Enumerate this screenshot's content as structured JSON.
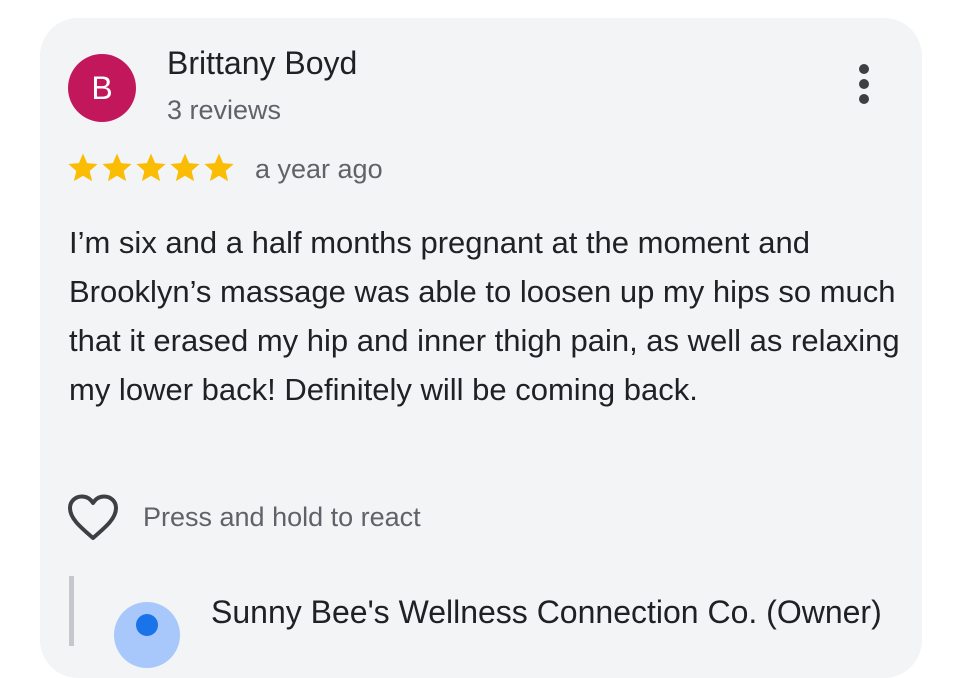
{
  "review": {
    "author_initial": "B",
    "author_name": "Brittany Boyd",
    "author_review_count": "3 reviews",
    "rating": 5,
    "rating_max": 5,
    "time": "a year ago",
    "text": "I’m six and a half months pregnant at the moment and Brooklyn’s massage was able to loosen up my hips so much that it erased my hip and inner thigh pain, as well as relaxing my lower back! Definitely will be coming back.",
    "react_label": "Press and hold to react"
  },
  "owner_response": {
    "name": "Sunny Bee's Wellness Connection Co. (Owner)"
  },
  "colors": {
    "avatar": "#c2185b",
    "star": "#fbbc04",
    "card_background": "#f3f4f6"
  },
  "icons": {
    "more": "more-vert-icon",
    "react": "heart-outline-icon",
    "rating": "star-icon"
  }
}
